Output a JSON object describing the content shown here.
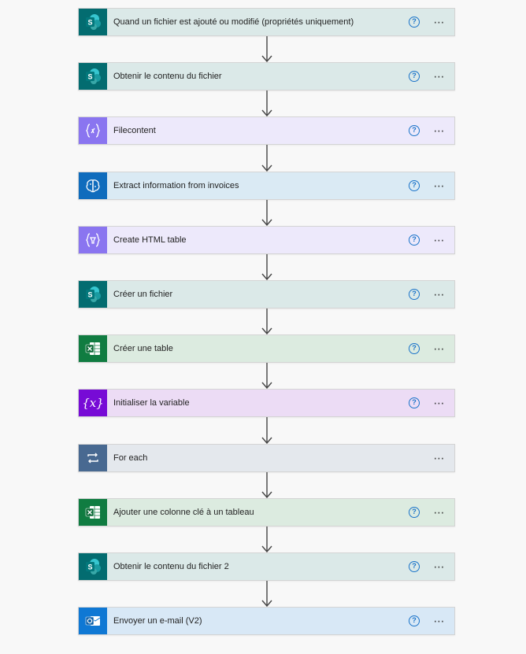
{
  "colors": {
    "sharepoint": {
      "icon_bg": "#036c70",
      "step_bg": "#dbe9e8"
    },
    "variable": {
      "icon_bg": "#8a75f0",
      "step_bg": "#ede9fb"
    },
    "ai": {
      "icon_bg": "#0f6cbd",
      "step_bg": "#daeaf4"
    },
    "excel": {
      "icon_bg": "#107c41",
      "step_bg": "#dcebe0"
    },
    "var_init": {
      "icon_bg": "#770bd6",
      "step_bg": "#ecdcf5"
    },
    "control": {
      "icon_bg": "#486991",
      "step_bg": "#e4e8ed"
    },
    "outlook": {
      "icon_bg": "#0f78d4",
      "step_bg": "#d8e8f6"
    },
    "help_icon": "#1a73c9",
    "arrow": "#444444"
  },
  "steps": [
    {
      "title": "Quand un fichier est ajouté ou modifié (propriétés uniquement)",
      "kind": "sharepoint",
      "icon": "sharepoint-icon",
      "has_help": true
    },
    {
      "title": "Obtenir le contenu du fichier",
      "kind": "sharepoint",
      "icon": "sharepoint-icon",
      "has_help": true
    },
    {
      "title": "Filecontent",
      "kind": "variable",
      "icon": "compose-icon",
      "has_help": true
    },
    {
      "title": "Extract information from invoices",
      "kind": "ai",
      "icon": "ai-brain-icon",
      "has_help": true
    },
    {
      "title": "Create HTML table",
      "kind": "variable",
      "icon": "table-operation-icon",
      "has_help": true
    },
    {
      "title": "Créer un fichier",
      "kind": "sharepoint",
      "icon": "sharepoint-icon",
      "has_help": true
    },
    {
      "title": "Créer une table",
      "kind": "excel",
      "icon": "excel-icon",
      "has_help": true
    },
    {
      "title": "Initialiser la variable",
      "kind": "var_init",
      "icon": "variable-icon",
      "has_help": true
    },
    {
      "title": "For each",
      "kind": "control",
      "icon": "loop-icon",
      "has_help": false
    },
    {
      "title": "Ajouter une colonne clé à un tableau",
      "kind": "excel",
      "icon": "excel-icon",
      "has_help": true
    },
    {
      "title": "Obtenir le contenu du fichier 2",
      "kind": "sharepoint",
      "icon": "sharepoint-icon",
      "has_help": true
    },
    {
      "title": "Envoyer un e-mail (V2)",
      "kind": "outlook",
      "icon": "outlook-icon",
      "has_help": true
    }
  ],
  "help_glyph": "?",
  "more_glyph": "⋯"
}
